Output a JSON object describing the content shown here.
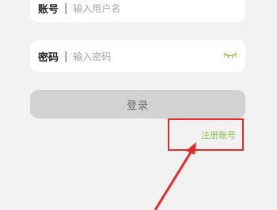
{
  "account": {
    "label": "账号",
    "separator": "|",
    "placeholder": "输入用户名"
  },
  "password": {
    "label": "密码",
    "separator": "|",
    "placeholder": "输入密码",
    "toggle_icon": "eye-closed-icon"
  },
  "login_button": {
    "label": "登录"
  },
  "register_link": {
    "label": "注册账号",
    "color": "#8cc24a"
  },
  "annotation": {
    "color": "#e52a2a"
  }
}
